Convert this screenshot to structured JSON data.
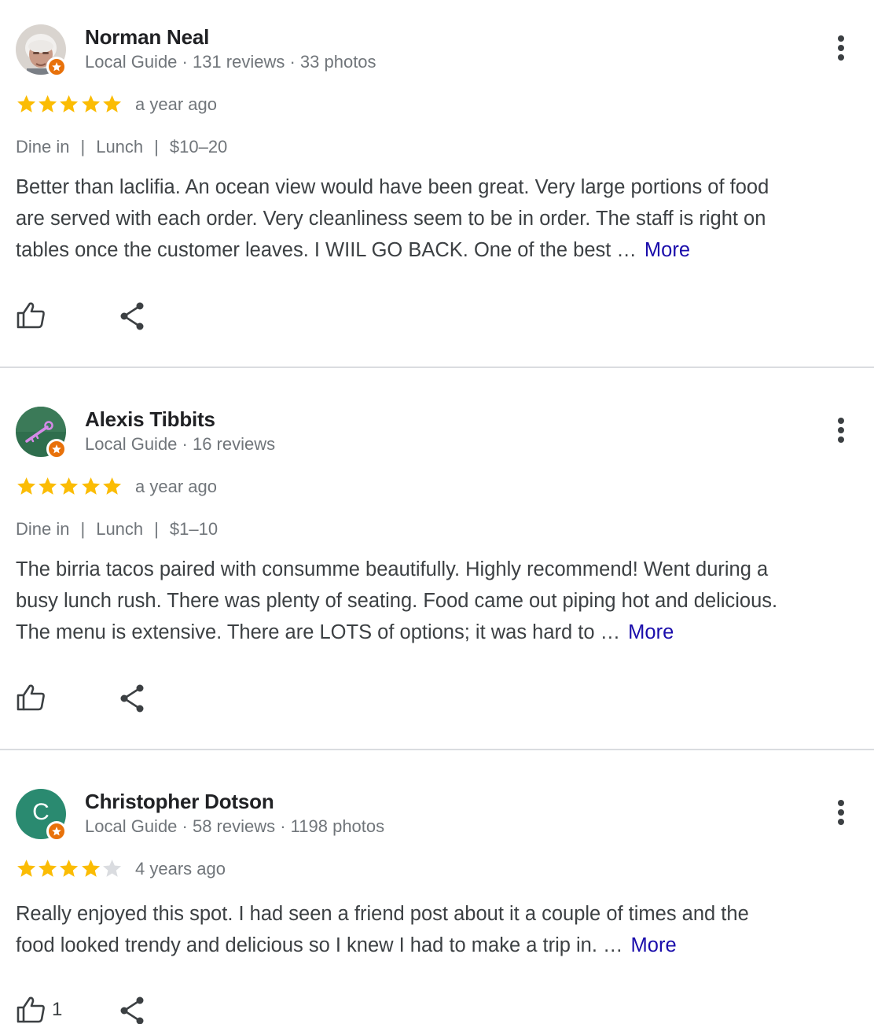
{
  "reviews": [
    {
      "name": "Norman Neal",
      "meta": "Local Guide · 131 reviews · 33 photos",
      "rating": 5,
      "when": "a year ago",
      "tags": [
        "Dine in",
        "Lunch",
        "$10–20"
      ],
      "text_lines": [
        "Better than laclifia. An ocean view would have been great. Very large portions of food",
        "are served with each order. Very cleanliness seem to be in order. The staff is right on",
        "tables once the customer leaves. I WIIL GO BACK. One of the best …"
      ],
      "more_label": "More",
      "like_count": ""
    },
    {
      "name": "Alexis Tibbits",
      "meta": "Local Guide · 16 reviews",
      "rating": 5,
      "when": "a year ago",
      "tags": [
        "Dine in",
        "Lunch",
        "$1–10"
      ],
      "text_lines": [
        "The birria tacos paired with consumme beautifully. Highly recommend! Went during a",
        "busy lunch rush. There was plenty of seating. Food came out piping hot and delicious.",
        "The menu is extensive. There are LOTS of options; it was hard to …"
      ],
      "more_label": "More",
      "like_count": ""
    },
    {
      "name": "Christopher Dotson",
      "avatar_letter": "C",
      "meta": "Local Guide · 58 reviews · 1198 photos",
      "rating": 4,
      "when": "4 years ago",
      "tags": [],
      "text_lines": [
        "Really enjoyed this spot. I had seen a friend post about it a couple of times and the",
        "food looked trendy and delicious so I knew I had to make a trip in. …"
      ],
      "more_label": "More",
      "like_count": "1"
    }
  ],
  "tag_separator": "|",
  "colors": {
    "star_filled": "#fbbc04",
    "star_empty": "#dadce0",
    "link": "#1a0dab",
    "badge": "#e8710a",
    "avatar_c": "#2a8a70"
  }
}
